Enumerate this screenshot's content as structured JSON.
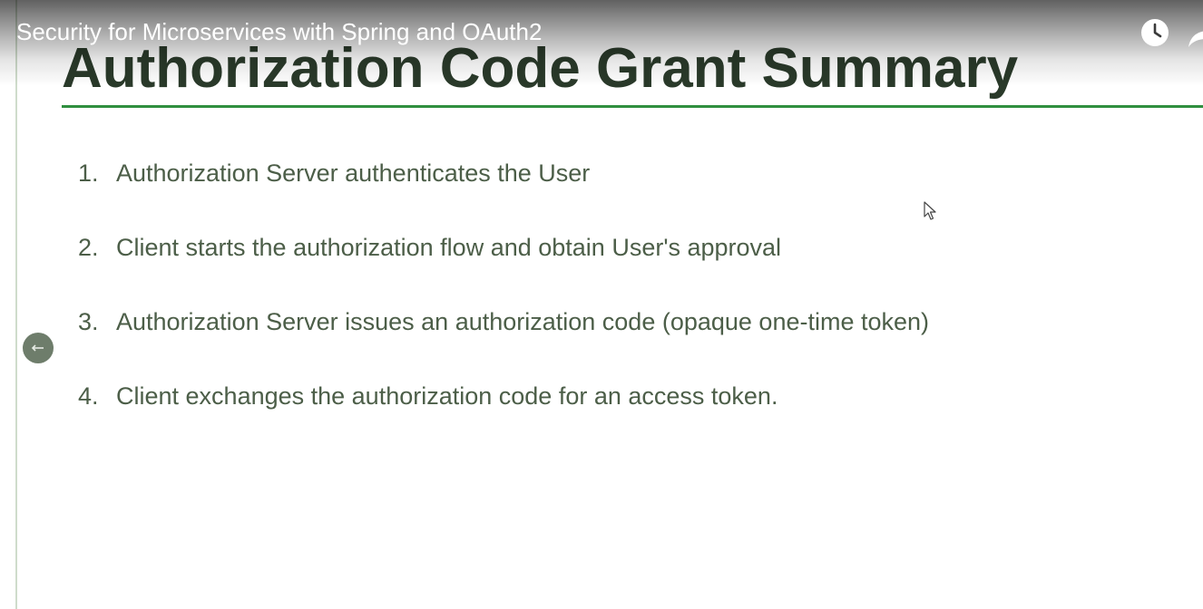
{
  "video": {
    "title": "Security for Microservices with Spring and OAuth2"
  },
  "controls": {
    "watch_later_icon": "clock-icon",
    "share_icon": "share-arrow-icon",
    "back_icon": "left-arrow-icon"
  },
  "slide": {
    "title": "Authorization Code Grant Summary",
    "steps": [
      {
        "number": "1.",
        "text": "Authorization Server authenticates the User"
      },
      {
        "number": "2.",
        "text": "Client starts the authorization flow and obtain User's approval"
      },
      {
        "number": "3.",
        "text": "Authorization Server issues an authorization code (opaque one-time token)"
      },
      {
        "number": "4.",
        "text": "Client exchanges the authorization code for an access token."
      }
    ]
  },
  "colors": {
    "title": "#2a3a2a",
    "underline": "#2f8f3f",
    "body_text": "#4c5e48",
    "back_button": "#6e7d6b"
  }
}
